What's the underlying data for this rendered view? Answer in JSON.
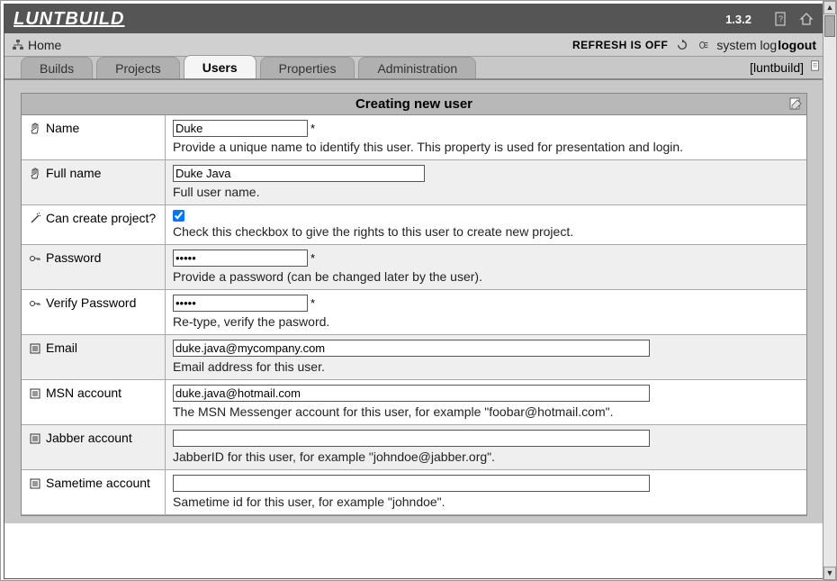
{
  "header": {
    "logo": "LUNTBUILD",
    "version": "1.3.2"
  },
  "nav": {
    "home": "Home",
    "refresh_label": "REFRESH IS OFF",
    "system_log": "system log",
    "logout": "logout"
  },
  "tabs": {
    "builds": "Builds",
    "projects": "Projects",
    "users": "Users",
    "properties": "Properties",
    "administration": "Administration",
    "current_user": "[luntbuild]"
  },
  "form": {
    "title": "Creating new user",
    "required_mark": "*",
    "fields": {
      "name": {
        "label": "Name",
        "value": "Duke",
        "desc": "Provide a unique name to identify this user. This property is used for presentation and login."
      },
      "fullname": {
        "label": "Full name",
        "value": "Duke Java",
        "desc": "Full user name."
      },
      "can_create": {
        "label": "Can create project?",
        "checked": true,
        "desc": "Check this checkbox to give the rights to this user to create new project."
      },
      "password": {
        "label": "Password",
        "value": "*****",
        "desc": "Provide a password (can be changed later by the user)."
      },
      "verify_password": {
        "label": "Verify Password",
        "value": "*****",
        "desc": "Re-type, verify the pasword."
      },
      "email": {
        "label": "Email",
        "value": "duke.java@mycompany.com",
        "desc": "Email address for this user."
      },
      "msn": {
        "label": "MSN account",
        "value": "duke.java@hotmail.com",
        "desc": "The MSN Messenger account for this user, for example \"foobar@hotmail.com\"."
      },
      "jabber": {
        "label": "Jabber account",
        "value": "",
        "desc": "JabberID for this user, for example \"johndoe@jabber.org\"."
      },
      "sametime": {
        "label": "Sametime account",
        "value": "",
        "desc": "Sametime id for this user, for example \"johndoe\"."
      }
    }
  }
}
